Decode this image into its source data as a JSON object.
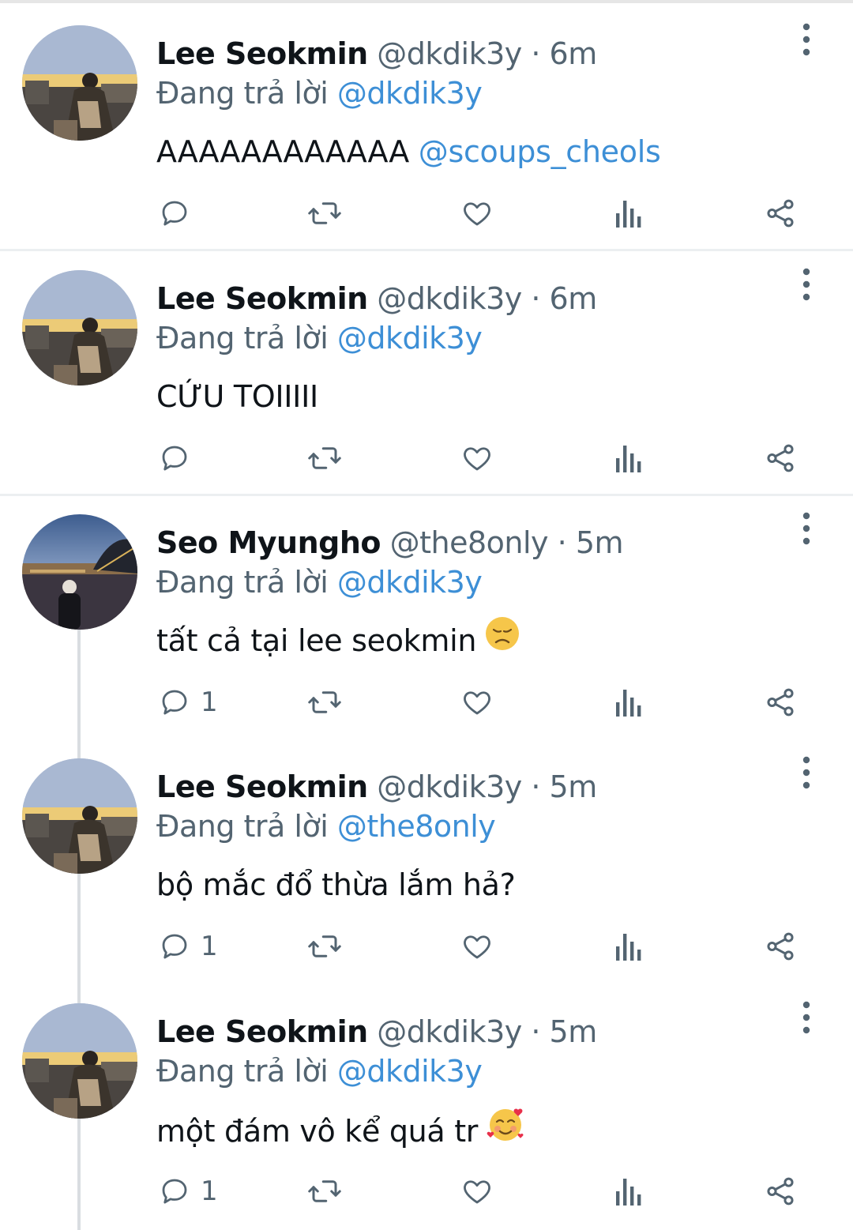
{
  "tweets": [
    {
      "name": "Lee Seokmin",
      "handle": "@dkdik3y",
      "separator": "·",
      "time": "6m",
      "reply_prefix": "Đang trả lời",
      "reply_to": "@dkdik3y",
      "text": "AAAAAAAAAAAA",
      "text_mention": "@scoups_cheols",
      "reply_count": "",
      "avatar": "lee-seokmin-avatar"
    },
    {
      "name": "Lee Seokmin",
      "handle": "@dkdik3y",
      "separator": "·",
      "time": "6m",
      "reply_prefix": "Đang trả lời",
      "reply_to": "@dkdik3y",
      "text": "CỨU TOIIIII",
      "text_mention": "",
      "reply_count": "",
      "avatar": "lee-seokmin-avatar"
    },
    {
      "name": "Seo Myungho",
      "handle": "@the8only",
      "separator": "·",
      "time": "5m",
      "reply_prefix": "Đang trả lời",
      "reply_to": "@dkdik3y",
      "text": "tất cả tại lee seokmin",
      "emoji": "disappointed-face-emoji",
      "text_mention": "",
      "reply_count": "1",
      "avatar": "seo-myungho-avatar"
    },
    {
      "name": "Lee Seokmin",
      "handle": "@dkdik3y",
      "separator": "·",
      "time": "5m",
      "reply_prefix": "Đang trả lời",
      "reply_to": "@the8only",
      "text": "bộ mắc đổ thừa lắm hả?",
      "text_mention": "",
      "reply_count": "1",
      "avatar": "lee-seokmin-avatar"
    },
    {
      "name": "Lee Seokmin",
      "handle": "@dkdik3y",
      "separator": "·",
      "time": "5m",
      "reply_prefix": "Đang trả lời",
      "reply_to": "@dkdik3y",
      "text": "một đám vô kể quá tr",
      "emoji": "smiling-face-with-hearts-emoji",
      "text_mention": "",
      "reply_count": "1",
      "avatar": "lee-seokmin-avatar"
    }
  ],
  "colors": {
    "text": "#0f1419",
    "secondary": "#536471",
    "mention": "#3d8fd6",
    "icon": "#536471",
    "divider": "#eceff1",
    "thread_line": "#d9dde1"
  },
  "icons": [
    "reply-icon",
    "retweet-icon",
    "like-icon",
    "analytics-icon",
    "share-icon",
    "more-icon"
  ]
}
